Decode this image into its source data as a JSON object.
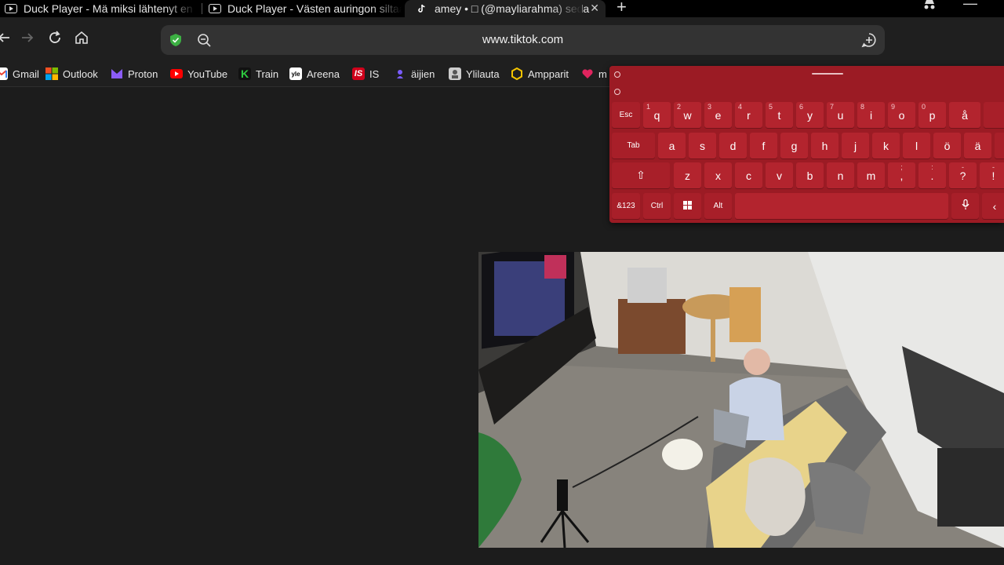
{
  "tabs": [
    {
      "title": "Duck Player - Mä miksi lähtenyt en",
      "active": false
    },
    {
      "title": "Duck Player - Västen auringon siltaa",
      "active": false
    },
    {
      "title": "amey • □ (@mayliarahma) seda",
      "active": true
    }
  ],
  "toolbar": {
    "url": "www.tiktok.com"
  },
  "bookmarks": [
    {
      "label": "Gmail",
      "icon": "gmail-icon",
      "color": "#ea4335"
    },
    {
      "label": "Outlook",
      "icon": "outlook-icon",
      "color": "#0078d4"
    },
    {
      "label": "Proton",
      "icon": "proton-icon",
      "color": "#8b5cf6"
    },
    {
      "label": "YouTube",
      "icon": "youtube-icon",
      "color": "#ff0000"
    },
    {
      "label": "Train",
      "icon": "train-icon",
      "color": "#2ecc40"
    },
    {
      "label": "Areena",
      "icon": "areena-icon",
      "color": "#ffffff"
    },
    {
      "label": "IS",
      "icon": "is-icon",
      "color": "#d0021b"
    },
    {
      "label": "äijien",
      "icon": "aijien-icon",
      "color": "#7a5cff"
    },
    {
      "label": "Ylilauta",
      "icon": "ylilauta-icon",
      "color": "#cccccc"
    },
    {
      "label": "Ampparit",
      "icon": "ampparit-icon",
      "color": "#f5c400"
    },
    {
      "label": "m",
      "icon": "heart-icon",
      "color": "#e0245e"
    }
  ],
  "keyboard": {
    "row1": [
      {
        "label": "Esc",
        "func": true
      },
      {
        "label": "q",
        "sup": "1"
      },
      {
        "label": "w",
        "sup": "2"
      },
      {
        "label": "e",
        "sup": "3"
      },
      {
        "label": "r",
        "sup": "4"
      },
      {
        "label": "t",
        "sup": "5"
      },
      {
        "label": "y",
        "sup": "6"
      },
      {
        "label": "u",
        "sup": "7"
      },
      {
        "label": "i",
        "sup": "8"
      },
      {
        "label": "o",
        "sup": "9"
      },
      {
        "label": "p",
        "sup": "0"
      },
      {
        "label": "å"
      },
      {
        "label": ""
      }
    ],
    "row2": [
      {
        "label": "Tab",
        "func": true
      },
      {
        "label": "a"
      },
      {
        "label": "s"
      },
      {
        "label": "d"
      },
      {
        "label": "f"
      },
      {
        "label": "g"
      },
      {
        "label": "h"
      },
      {
        "label": "j"
      },
      {
        "label": "k"
      },
      {
        "label": "l"
      },
      {
        "label": "ö"
      },
      {
        "label": "ä"
      }
    ],
    "row3": [
      {
        "label": "⇧",
        "func": true
      },
      {
        "label": "z"
      },
      {
        "label": "x"
      },
      {
        "label": "c"
      },
      {
        "label": "v"
      },
      {
        "label": "b"
      },
      {
        "label": "n"
      },
      {
        "label": "m"
      },
      {
        "label": ",",
        "sup": ";"
      },
      {
        "label": ".",
        "sup": ":"
      },
      {
        "label": "?",
        "sup": "-"
      },
      {
        "label": "!",
        "sup": "-"
      }
    ],
    "row4": [
      {
        "label": "&123",
        "func": true
      },
      {
        "label": "Ctrl",
        "func": true
      },
      {
        "label": "⊞",
        "func": true
      },
      {
        "label": "Alt",
        "func": true
      },
      {
        "label": "",
        "func": true
      },
      {
        "label": "🎙",
        "func": true
      },
      {
        "label": "‹",
        "func": true
      }
    ]
  }
}
